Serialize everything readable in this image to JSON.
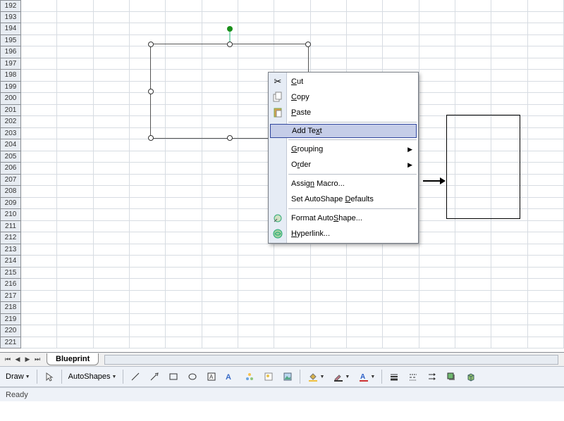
{
  "rows": [
    192,
    193,
    194,
    195,
    196,
    197,
    198,
    199,
    200,
    201,
    202,
    203,
    204,
    205,
    206,
    207,
    208,
    209,
    210,
    211,
    212,
    213,
    214,
    215,
    216,
    217,
    218,
    219,
    220,
    221
  ],
  "context_menu": {
    "cut": "Cut",
    "copy": "Copy",
    "paste": "Paste",
    "add_text": "Add Text",
    "grouping": "Grouping",
    "order": "Order",
    "assign_macro": "Assign Macro...",
    "set_defaults": "Set AutoShape Defaults",
    "format_autoshape": "Format AutoShape...",
    "hyperlink": "Hyperlink..."
  },
  "sheet_tab": "Blueprint",
  "toolbar": {
    "draw_label": "Draw",
    "autoshapes_label": "AutoShapes"
  },
  "status_text": "Ready"
}
